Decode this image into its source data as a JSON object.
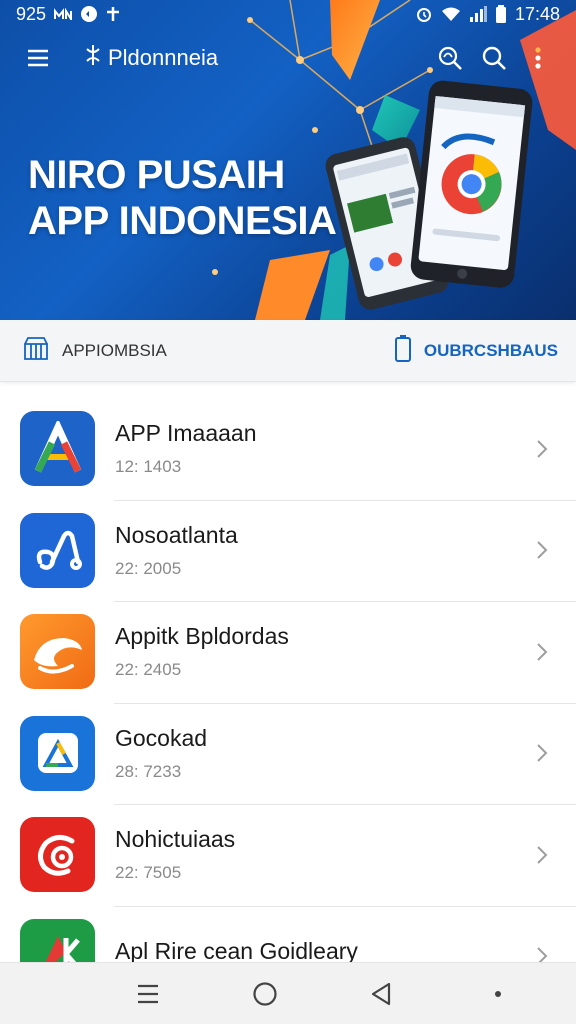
{
  "status_bar": {
    "left_text": "925",
    "left_icons": [
      "mail-icon",
      "message-icon",
      "plus-icon"
    ],
    "right_icons": [
      "alarm-icon",
      "wifi-icon",
      "signal-icon",
      "battery-icon"
    ],
    "time": "17:48"
  },
  "app_bar": {
    "title": "Pldonnneia",
    "actions": [
      "headset-search-icon",
      "search-icon",
      "more-vert-icon"
    ]
  },
  "hero": {
    "title_line1": "NIRO PUSAIH",
    "title_line2": "APP INDONESIA"
  },
  "tabs": {
    "left_label": "APPIOMBSIA",
    "right_label": "OUBRCSHBAUS"
  },
  "apps": [
    {
      "name": "APP Imaaaan",
      "time": "12: 1403",
      "icon": "a-letter-icon",
      "color": "#1e63c7"
    },
    {
      "name": "Nosoatlanta",
      "time": "22: 2005",
      "icon": "loop-link-icon",
      "color": "#1f66d6"
    },
    {
      "name": "Appitk Bpldordas",
      "time": "22: 2405",
      "icon": "swoosh-icon",
      "color": "#f58a1f"
    },
    {
      "name": "Gocokad",
      "time": "28: 7233",
      "icon": "drive-triangle-icon",
      "color": "#1a73d8"
    },
    {
      "name": "Nohictuiaas",
      "time": "22: 7505",
      "icon": "target-swirl-icon",
      "color": "#e2261f"
    },
    {
      "name": "Apl Rire cean Goidleary",
      "time": "",
      "icon": "k-letter-icon",
      "color": "#1e9c45"
    }
  ],
  "nav": {
    "items": [
      "menu-icon",
      "home-circle-icon",
      "back-triangle-icon",
      "dot-icon"
    ]
  },
  "colors": {
    "primary": "#1361c4",
    "accent_blue": "#1565c0",
    "divider": "#e6e6e6"
  }
}
